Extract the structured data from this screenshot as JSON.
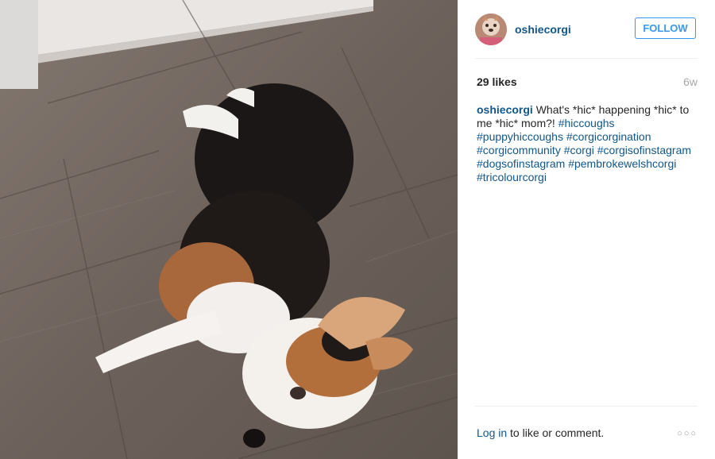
{
  "post": {
    "username": "oshiecorgi",
    "follow_label": "FOLLOW",
    "likes": "29 likes",
    "age": "6w",
    "caption_text": "What's *hic* happening *hic* to me *hic* mom?! ",
    "hashtags": [
      "#hiccoughs",
      "#puppyhiccoughs",
      "#corgicorgination",
      "#corgicommunity",
      "#corgi",
      "#corgisofinstagram",
      "#dogsofinstagram",
      "#pembrokewelshcorgi",
      "#tricolourcorgi"
    ],
    "login_link": "Log in",
    "login_rest": " to like or comment.",
    "more_icon": "○○○"
  },
  "colors": {
    "link": "#125688",
    "follow": "#3897f0"
  }
}
